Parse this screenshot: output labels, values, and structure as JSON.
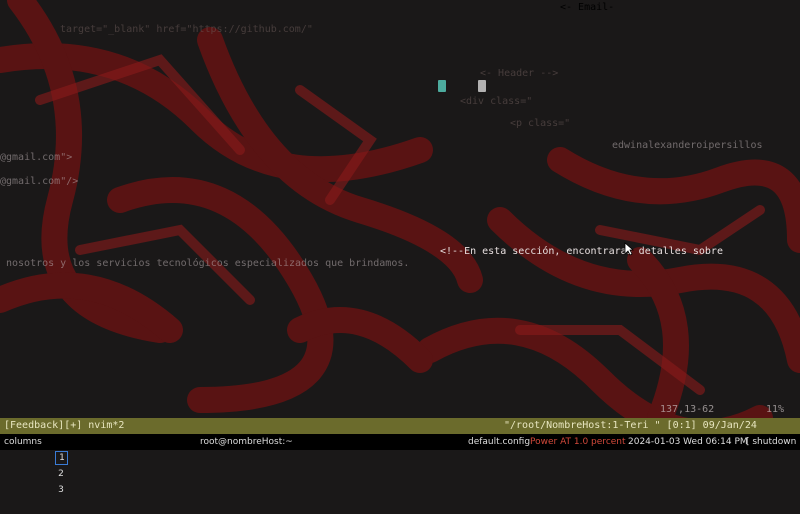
{
  "editor": {
    "lines_top": [
      {
        "text": "<- Email-",
        "cls": "dim"
      },
      {
        "text": "target=\"_blank\" href=\"https://github.com/\"",
        "cls": "dim"
      },
      {
        "text": "<- Header -->",
        "cls": "dim"
      }
    ],
    "left_lines": [
      {
        "text": "@gmail.com\">",
        "cls": "mid"
      },
      {
        "text": "@gmail.com\"/>",
        "cls": "mid"
      },
      {
        "text": "nosotros y los servicios tecnológicos especializados que brindamos.",
        "cls": "mid"
      }
    ],
    "right_lines": [
      {
        "text": "edwinalexanderoipersillos",
        "cls": "mid"
      },
      {
        "text": "<!--En esta sección, encontraras detalles sobre",
        "cls": "bright"
      },
      {
        "text": "<div class=\"",
        "cls": "dim"
      },
      {
        "text": "<p class=\"",
        "cls": "dim"
      }
    ],
    "cursor_position": "137,13-62",
    "scroll_percent": "11%"
  },
  "vim_status": {
    "left": "[Feedback][+] nvim*2",
    "right": "\"/root/NombreHost:1-Teri \" [0:1] 09/Jan/24"
  },
  "panel": {
    "columns_label": "columns",
    "workspaces": [
      "1",
      "2",
      "3"
    ],
    "active_workspace": "1",
    "window_title": "root@nombreHost:~",
    "config": "default.config",
    "battery": "Power AT 1.0 percent",
    "datetime": "2024-01-03 Wed 06:14 PM",
    "shutdown": "[ shutdown ]"
  },
  "colors": {
    "wallpaper_red": "#7a1212",
    "status_bar": "#6b6b2c",
    "cursor": "#2fbfa4"
  }
}
